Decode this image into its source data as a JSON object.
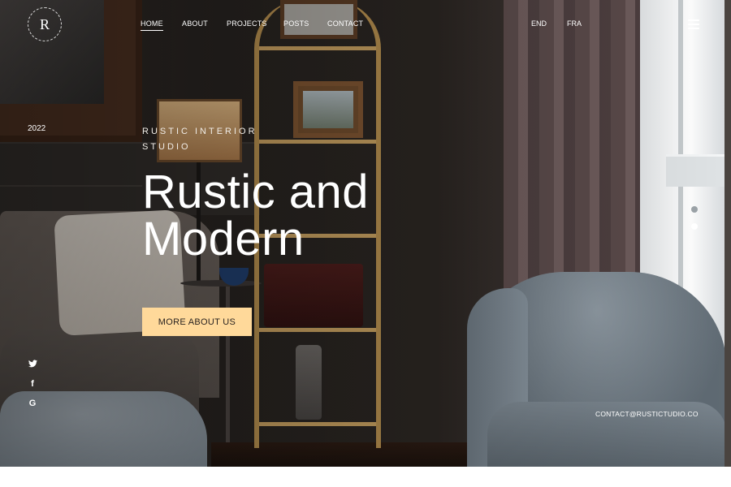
{
  "logo": {
    "letter": "R"
  },
  "nav": {
    "items": [
      {
        "label": "HOME",
        "active": true
      },
      {
        "label": "ABOUT",
        "active": false
      },
      {
        "label": "PROJECTS",
        "active": false
      },
      {
        "label": "POSTS",
        "active": false
      },
      {
        "label": "CONTACT",
        "active": false
      }
    ]
  },
  "languages": [
    "END",
    "FRA"
  ],
  "hero": {
    "year": "2022",
    "eyebrow": "RUSTIC INTERIOR STUDIO",
    "headline": "Rustic and Modern",
    "cta_label": "MORE ABOUT US",
    "email": "CONTACT@RUSTICTUDIO.CO"
  },
  "social": [
    {
      "icon": "twitter-icon",
      "glyph": "🐦"
    },
    {
      "icon": "facebook-icon",
      "glyph": "f"
    },
    {
      "icon": "google-icon",
      "glyph": "G"
    }
  ],
  "slider": {
    "total": 2,
    "active_index": 1
  },
  "colors": {
    "accent": "#ffd99a",
    "text": "#ffffff",
    "dot_inactive": "#9aa1a6"
  }
}
